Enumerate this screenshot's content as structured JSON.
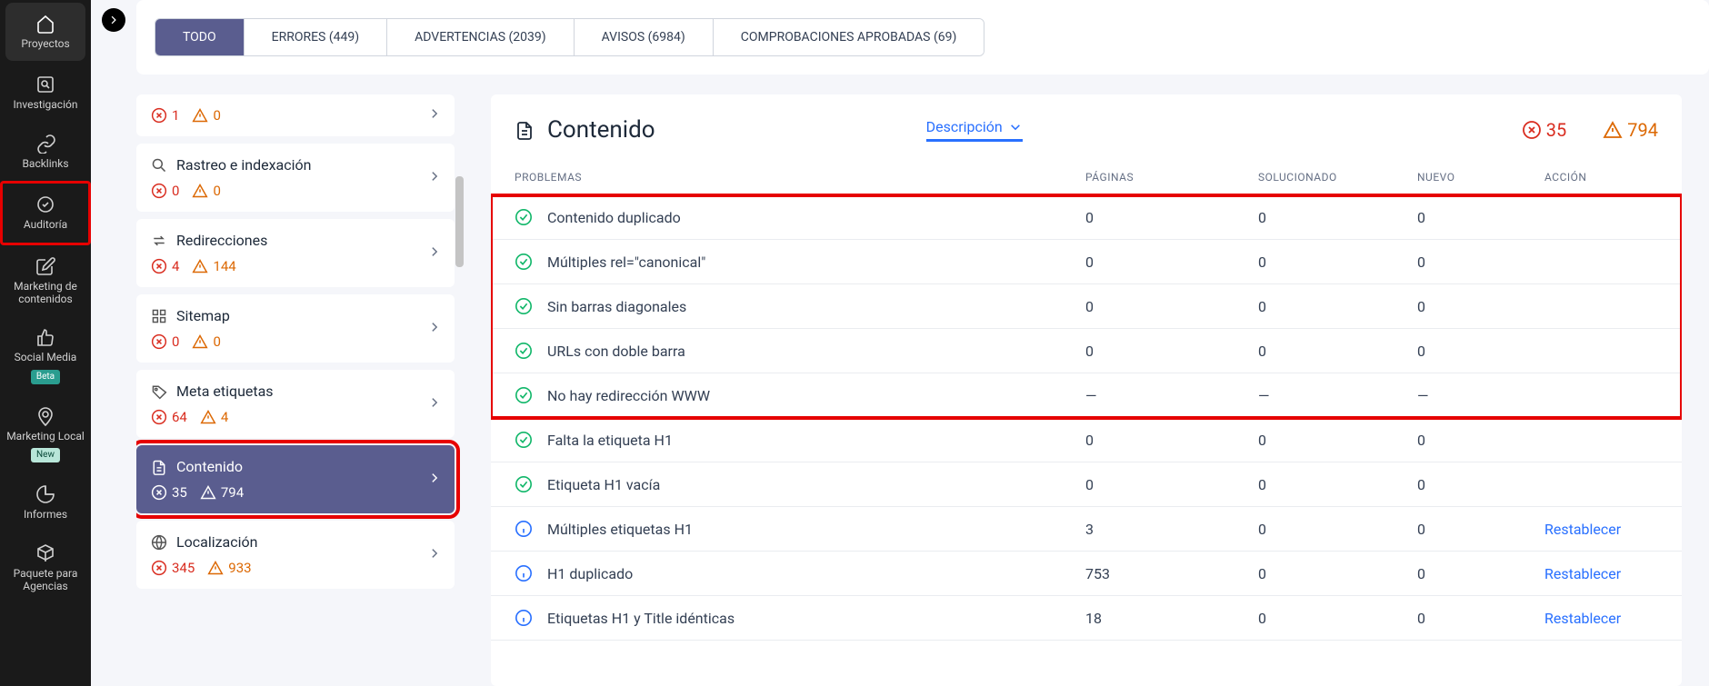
{
  "nav": {
    "items": [
      {
        "label": "Proyectos",
        "active": true
      },
      {
        "label": "Investigación"
      },
      {
        "label": "Backlinks"
      },
      {
        "label": "Auditoría",
        "highlight": true
      },
      {
        "label": "Marketing de contenidos"
      },
      {
        "label": "Social Media",
        "badge": "Beta",
        "badgeType": "beta"
      },
      {
        "label": "Marketing Local",
        "badge": "New",
        "badgeType": "new"
      },
      {
        "label": "Informes"
      },
      {
        "label": "Paquete para Agencias"
      }
    ]
  },
  "tabs": [
    {
      "label": "TODO",
      "active": true
    },
    {
      "label": "ERRORES (449)"
    },
    {
      "label": "ADVERTENCIAS (2039)"
    },
    {
      "label": "AVISOS (6984)"
    },
    {
      "label": "COMPROBACIONES APROBADAS (69)"
    }
  ],
  "categories": [
    {
      "partial": true,
      "err": "1",
      "warn": "0"
    },
    {
      "title": "Rastreo e indexación",
      "err": "0",
      "warn": "0",
      "icon": "search"
    },
    {
      "title": "Redirecciones",
      "err": "4",
      "warn": "144",
      "icon": "redirect"
    },
    {
      "title": "Sitemap",
      "err": "0",
      "warn": "0",
      "icon": "grid"
    },
    {
      "title": "Meta etiquetas",
      "err": "64",
      "warn": "4",
      "icon": "tag"
    },
    {
      "title": "Contenido",
      "err": "35",
      "warn": "794",
      "icon": "doc",
      "active": true,
      "highlight": true
    },
    {
      "title": "Localización",
      "err": "345",
      "warn": "933",
      "icon": "globe"
    }
  ],
  "detail": {
    "title": "Contenido",
    "dropdown": "Descripción",
    "summary_err": "35",
    "summary_warn": "794",
    "columns": {
      "problem": "PROBLEMAS",
      "pages": "PÁGINAS",
      "solved": "SOLUCIONADO",
      "new": "NUEVO",
      "action": "ACCIÓN"
    },
    "rows": [
      {
        "status": "ok",
        "name": "Contenido duplicado",
        "pages": "0",
        "solved": "0",
        "new": "0",
        "hl": true
      },
      {
        "status": "ok",
        "name": "Múltiples rel=\"canonical\"",
        "pages": "0",
        "solved": "0",
        "new": "0",
        "hl": true
      },
      {
        "status": "ok",
        "name": "Sin barras diagonales",
        "pages": "0",
        "solved": "0",
        "new": "0",
        "hl": true
      },
      {
        "status": "ok",
        "name": "URLs con doble barra",
        "pages": "0",
        "solved": "0",
        "new": "0",
        "hl": true
      },
      {
        "status": "ok",
        "name": "No hay redirección WWW",
        "pages": "—",
        "solved": "—",
        "new": "—",
        "hl": true
      },
      {
        "status": "ok",
        "name": "Falta la etiqueta H1",
        "pages": "0",
        "solved": "0",
        "new": "0"
      },
      {
        "status": "ok",
        "name": "Etiqueta H1 vacía",
        "pages": "0",
        "solved": "0",
        "new": "0"
      },
      {
        "status": "info",
        "name": "Múltiples etiquetas H1",
        "pages": "3",
        "solved": "0",
        "new": "0",
        "action": "Restablecer"
      },
      {
        "status": "info",
        "name": "H1 duplicado",
        "pages": "753",
        "solved": "0",
        "new": "0",
        "action": "Restablecer"
      },
      {
        "status": "info",
        "name": "Etiquetas H1 y Title idénticas",
        "pages": "18",
        "solved": "0",
        "new": "0",
        "action": "Restablecer"
      }
    ]
  }
}
